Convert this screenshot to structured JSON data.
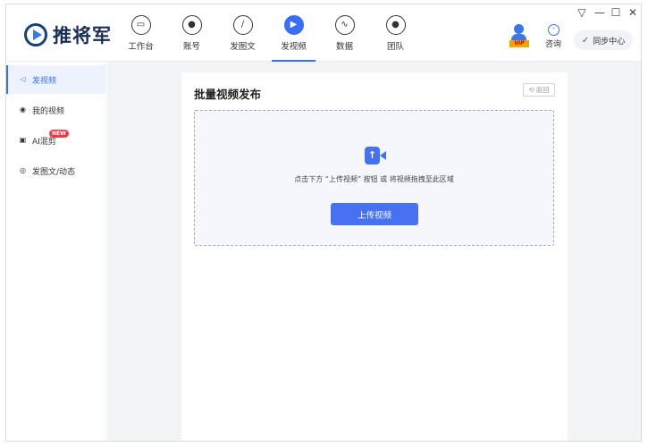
{
  "app": {
    "brand": "推将军"
  },
  "nav": {
    "items": [
      {
        "label": "工作台",
        "icon": "monitor-icon",
        "glyph": "▭",
        "active": false
      },
      {
        "label": "账号",
        "icon": "user-icon",
        "glyph": "●",
        "active": false
      },
      {
        "label": "发图文",
        "icon": "feather-icon",
        "glyph": "∕",
        "active": false
      },
      {
        "label": "发视频",
        "icon": "play-icon",
        "glyph": "▶",
        "active": true
      },
      {
        "label": "数据",
        "icon": "chart-icon",
        "glyph": "∿",
        "active": false
      },
      {
        "label": "团队",
        "icon": "team-icon",
        "glyph": "●",
        "active": false
      }
    ]
  },
  "header": {
    "vip_tag": "VIP",
    "consult_label": "咨询",
    "consult_glyph": "···",
    "sync_label": "同步中心",
    "window_controls": {
      "menu": "▽",
      "minimize": "—",
      "maximize": "☐",
      "close": "✕"
    }
  },
  "sidebar": {
    "items": [
      {
        "label": "发视频",
        "icon": "send-icon",
        "glyph": "◁",
        "active": true
      },
      {
        "label": "我的视频",
        "icon": "play-circle-icon",
        "glyph": "◉",
        "active": false
      },
      {
        "label": "AI混剪",
        "icon": "robot-icon",
        "glyph": "▣",
        "active": false,
        "badge": "NEW"
      },
      {
        "label": "发图文/动态",
        "icon": "compass-icon",
        "glyph": "◎",
        "active": false
      }
    ]
  },
  "main": {
    "title": "批量视频发布",
    "back_label": "返回",
    "back_glyph": "⟲",
    "upload_glyph": "↑",
    "drop_hint": "点击下方 “上传视频” 按钮 或 将视频拖拽至此区域",
    "upload_button": "上传视频"
  },
  "colors": {
    "accent": "#3a6ff5",
    "button": "#4671f0",
    "badge": "#f03a4a"
  }
}
